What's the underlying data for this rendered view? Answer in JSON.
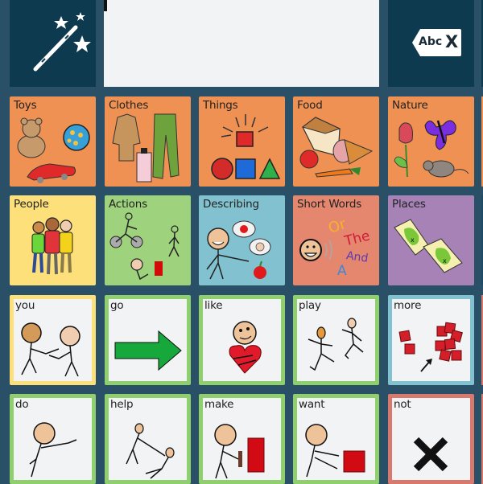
{
  "toolbar": {
    "magic_wand_button": "magic-wand",
    "clear_button_text": "Abc",
    "clear_button_x": "X"
  },
  "message_bar": {
    "text": ""
  },
  "colors": {
    "background": "#2a5068",
    "toolbar_button": "#0e3a50",
    "message_bar": "#f1f3f5",
    "category_orange": "#ee9153",
    "people_yellow": "#fde07a",
    "actions_green": "#9ed27d",
    "describing_blue": "#82c1cf",
    "shortwords_salmon": "#e5866f",
    "places_purple": "#a682b6",
    "border_green": "#8fcf6d",
    "border_yellow": "#fde07a",
    "border_blue": "#82c1cf",
    "border_red": "#d9786c"
  },
  "grid": {
    "row1": [
      {
        "label": "Toys"
      },
      {
        "label": "Clothes"
      },
      {
        "label": "Things"
      },
      {
        "label": "Food"
      },
      {
        "label": "Nature"
      }
    ],
    "row2": [
      {
        "label": "People"
      },
      {
        "label": "Actions"
      },
      {
        "label": "Describing"
      },
      {
        "label": "Short Words",
        "words": [
          "Or",
          "The",
          "And",
          "A"
        ]
      },
      {
        "label": "Places"
      }
    ],
    "row3": [
      {
        "label": "you"
      },
      {
        "label": "go"
      },
      {
        "label": "like"
      },
      {
        "label": "play"
      },
      {
        "label": "more"
      }
    ],
    "row4": [
      {
        "label": "do"
      },
      {
        "label": "help"
      },
      {
        "label": "make"
      },
      {
        "label": "want"
      },
      {
        "label": "not"
      }
    ]
  }
}
